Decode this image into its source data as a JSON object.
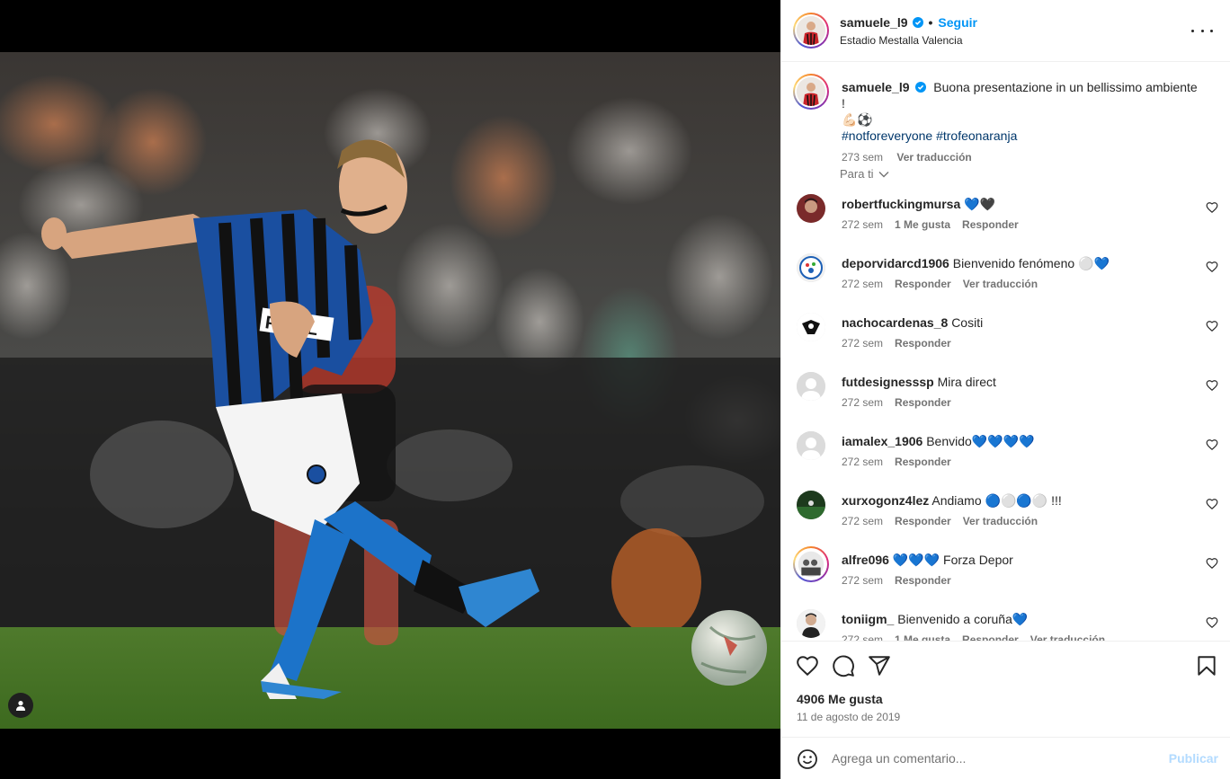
{
  "post": {
    "username": "samuele_l9",
    "follow_label": "Seguir",
    "separator": "•",
    "location": "Estadio Mestalla Valencia",
    "caption_text": "Buona presentazione in un bellissimo ambiente !",
    "caption_emojis": "💪🏻⚽",
    "hashtags": "#notforeveryone #trofeonaranja",
    "caption_time": "273 sem",
    "translate_label": "Ver traducción",
    "for_you_label": "Para ti",
    "likes": "4906 Me gusta",
    "date": "11 de agosto de 2019",
    "comment_placeholder": "Agrega un comentario...",
    "publish_label": "Publicar"
  },
  "comments": [
    {
      "user": "robertfuckingmursa",
      "text": "💙🖤",
      "time": "272 sem",
      "likes": "1 Me gusta",
      "reply": "Responder",
      "translate": ""
    },
    {
      "user": "deporvidarcd1906",
      "text": "Bienvenido fenómeno ⚪💙",
      "time": "272 sem",
      "likes": "",
      "reply": "Responder",
      "translate": "Ver traducción"
    },
    {
      "user": "nachocardenas_8",
      "text": "Cositi",
      "time": "272 sem",
      "likes": "",
      "reply": "Responder",
      "translate": ""
    },
    {
      "user": "futdesignesssp",
      "text": "Mira direct",
      "time": "272 sem",
      "likes": "",
      "reply": "Responder",
      "translate": ""
    },
    {
      "user": "iamalex_1906",
      "text": "Benvido💙💙💙💙",
      "time": "272 sem",
      "likes": "",
      "reply": "Responder",
      "translate": ""
    },
    {
      "user": "xurxogonz4lez",
      "text": "Andiamo 🔵⚪🔵⚪ !!!",
      "time": "272 sem",
      "likes": "",
      "reply": "Responder",
      "translate": "Ver traducción"
    },
    {
      "user": "alfre096",
      "text": "💙💙💙 Forza Depor",
      "time": "272 sem",
      "likes": "",
      "reply": "Responder",
      "translate": ""
    },
    {
      "user": "toniigm_",
      "text": "Bienvenido a coruña💙",
      "time": "272 sem",
      "likes": "1 Me gusta",
      "reply": "Responder",
      "translate": "Ver traducción"
    }
  ],
  "colors": {
    "accent": "#0095f6",
    "hashtag": "#00376b",
    "muted": "#737373"
  }
}
